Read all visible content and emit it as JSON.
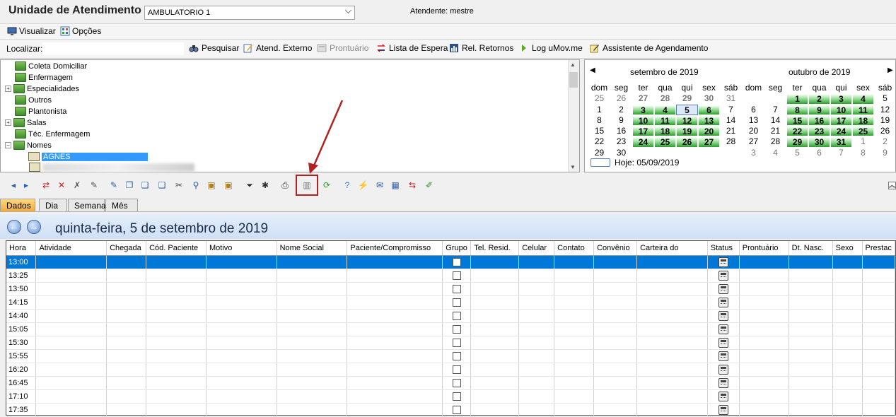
{
  "header": {
    "title": "Unidade de Atendimento",
    "unit_value": "AMBULATORIO 1",
    "attendant": "Atendente: mestre"
  },
  "menu": {
    "view": "Visualizar",
    "options": "Opções"
  },
  "find": {
    "label": "Localizar:",
    "buttons": {
      "search": "Pesquisar",
      "external": "Atend. Externo",
      "record": "Prontuário",
      "waitlist": "Lista de Espera",
      "returns": "Rel. Retornos",
      "umov": "Log uMov.me",
      "wizard": "Assistente de Agendamento"
    }
  },
  "tree": {
    "items": [
      "Coleta Domiciliar",
      "Enfermagem",
      "Especialidades",
      "Outros",
      "Plantonista",
      "Salas",
      "Téc. Enfermagem",
      "Nomes"
    ],
    "selected": "AGNES"
  },
  "calendar": {
    "month1": "setembro de 2019",
    "month2": "outubro de 2019",
    "weekdays": [
      "dom",
      "seg",
      "ter",
      "qua",
      "qui",
      "sex",
      "sáb"
    ],
    "today_label": "Hoje: 05/09/2019",
    "sep_days": [
      "25",
      "26",
      "27",
      "28",
      "29",
      "30",
      "31",
      "1",
      "2",
      "3",
      "4",
      "5",
      "6",
      "7",
      "8",
      "9",
      "10",
      "11",
      "12",
      "13",
      "14",
      "15",
      "16",
      "17",
      "18",
      "19",
      "20",
      "21",
      "22",
      "23",
      "24",
      "25",
      "26",
      "27",
      "28",
      "29",
      "30",
      "",
      "",
      "",
      "",
      ""
    ],
    "oct_days": [
      "",
      "",
      "1",
      "2",
      "3",
      "4",
      "5",
      "6",
      "7",
      "8",
      "9",
      "10",
      "11",
      "12",
      "13",
      "14",
      "15",
      "16",
      "17",
      "18",
      "19",
      "20",
      "21",
      "22",
      "23",
      "24",
      "25",
      "26",
      "27",
      "28",
      "29",
      "30",
      "31",
      "1",
      "2",
      "3",
      "4",
      "5",
      "6",
      "7",
      "8",
      "9"
    ]
  },
  "tabs": [
    "Dados",
    "Dia",
    "Semana",
    "Mês"
  ],
  "date_title": "quinta-feira, 5 de setembro de 2019",
  "grid": {
    "columns": [
      "Hora",
      "Atividade",
      "Chegada",
      "Cód. Paciente",
      "Motivo",
      "Nome Social",
      "Paciente/Compromisso",
      "Grupo",
      "Tel. Resid.",
      "Celular",
      "Contato",
      "Convênio",
      "Carteira do",
      "Status",
      "Prontuário",
      "Dt. Nasc.",
      "Sexo",
      "Prestac"
    ],
    "times": [
      "13:00",
      "13:25",
      "13:50",
      "14:15",
      "14:40",
      "15:05",
      "15:30",
      "15:55",
      "16:20",
      "16:45",
      "17:10",
      "17:35"
    ]
  },
  "colors": {
    "accent_blue": "#0078d7",
    "calendar_green": "#2e9e2e",
    "highlight_red": "#b22222"
  }
}
